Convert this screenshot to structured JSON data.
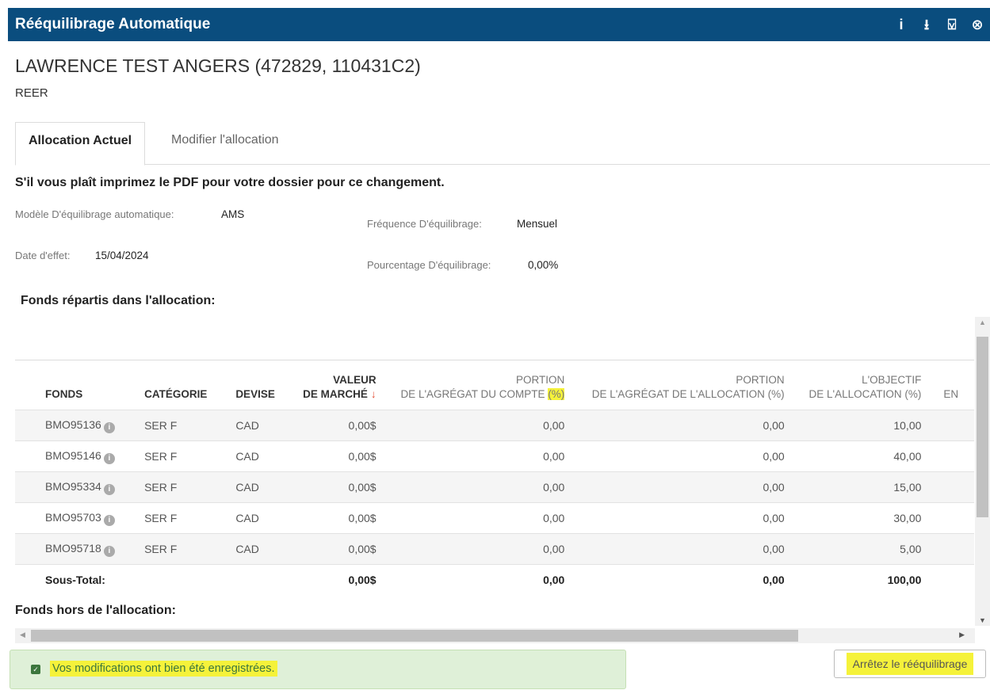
{
  "header": {
    "title": "Rééquilibrage Automatique",
    "icons": [
      "info-icon",
      "download-icon",
      "pdf-icon",
      "close-icon"
    ],
    "icon_glyphs": {
      "info": "i",
      "download": "⭳",
      "pdf": "⍌",
      "close": "⊗"
    }
  },
  "client": {
    "name": "LAWRENCE TEST ANGERS (472829, 110431C2)",
    "account_type": "REER"
  },
  "tabs": {
    "active": "Allocation Actuel",
    "inactive": "Modifier l'allocation"
  },
  "notice": "S'il vous plaît imprimez le PDF pour votre dossier pour ce changement.",
  "details": {
    "model_label": "Modèle D'équilibrage automatique:",
    "model_value": "AMS",
    "frequency_label": "Fréquence D'équilibrage:",
    "frequency_value": "Mensuel",
    "date_label": "Date d'effet:",
    "date_value": "15/04/2024",
    "percent_label": "Pourcentage D'équilibrage:",
    "percent_value": "0,00%"
  },
  "sections": {
    "in_allocation": "Fonds répartis dans l'allocation:",
    "out_allocation": "Fonds hors de l'allocation:"
  },
  "table": {
    "headers": {
      "fonds": "FONDS",
      "categorie": "CATÉGORIE",
      "devise": "DEVISE",
      "valeur_top": "VALEUR",
      "valeur_bottom": "DE MARCHÉ",
      "valeur_arrow": "↓",
      "portion_compte_top": "PORTION",
      "portion_compte_bottom": "DE L'AGRÉGAT DU COMPTE",
      "portion_compte_pct": "(%)",
      "portion_alloc_top": "PORTION",
      "portion_alloc_bottom": "DE L'AGRÉGAT DE L'ALLOCATION (%)",
      "objectif_top": "L'OBJECTIF",
      "objectif_bottom": "DE L'ALLOCATION (%)",
      "cut_col": "EN"
    },
    "info_glyph": "i",
    "rows": [
      {
        "fonds": "BMO95136",
        "categorie": "SER F",
        "devise": "CAD",
        "valeur": "0,00$",
        "portion_compte": "0,00",
        "portion_alloc": "0,00",
        "objectif": "10,00"
      },
      {
        "fonds": "BMO95146",
        "categorie": "SER F",
        "devise": "CAD",
        "valeur": "0,00$",
        "portion_compte": "0,00",
        "portion_alloc": "0,00",
        "objectif": "40,00"
      },
      {
        "fonds": "BMO95334",
        "categorie": "SER F",
        "devise": "CAD",
        "valeur": "0,00$",
        "portion_compte": "0,00",
        "portion_alloc": "0,00",
        "objectif": "15,00"
      },
      {
        "fonds": "BMO95703",
        "categorie": "SER F",
        "devise": "CAD",
        "valeur": "0,00$",
        "portion_compte": "0,00",
        "portion_alloc": "0,00",
        "objectif": "30,00"
      },
      {
        "fonds": "BMO95718",
        "categorie": "SER F",
        "devise": "CAD",
        "valeur": "0,00$",
        "portion_compte": "0,00",
        "portion_alloc": "0,00",
        "objectif": "5,00"
      }
    ],
    "subtotal": {
      "label": "Sous-Total:",
      "valeur": "0,00$",
      "portion_compte": "0,00",
      "portion_alloc": "0,00",
      "objectif": "100,00"
    }
  },
  "success_message": "Vos modifications ont bien été enregistrées.",
  "check_glyph": "✓",
  "stop_button": "Arrêtez le rééquilibrage",
  "colors": {
    "header_bg": "#0a4d7e",
    "highlight": "#f5f23a",
    "success_bg": "#dff0d8",
    "sort_arrow": "#e2452b"
  }
}
